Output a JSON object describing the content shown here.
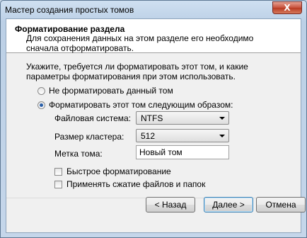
{
  "window": {
    "title": "Мастер создания простых томов",
    "close_label": "X"
  },
  "header": {
    "title": "Форматирование раздела",
    "description": "Для сохранения данных на этом разделе его необходимо сначала отформатировать."
  },
  "instructions": "Укажите, требуется ли форматировать этот том, и какие параметры форматирования при этом использовать.",
  "options": {
    "no_format": {
      "label": "Не форматировать данный том",
      "selected": false
    },
    "format": {
      "label": "Форматировать этот том следующим образом:",
      "selected": true
    }
  },
  "fields": {
    "filesystem": {
      "label": "Файловая система:",
      "value": "NTFS"
    },
    "cluster": {
      "label": "Размер кластера:",
      "value": "512"
    },
    "volume_label": {
      "label": "Метка тома:",
      "value": "Новый том"
    }
  },
  "checkboxes": {
    "quick_format": {
      "label": "Быстрое форматирование",
      "checked": false
    },
    "compression": {
      "label": "Применять сжатие файлов и папок",
      "checked": false
    }
  },
  "buttons": {
    "back": "< Назад",
    "next": "Далее >",
    "cancel": "Отмена"
  }
}
